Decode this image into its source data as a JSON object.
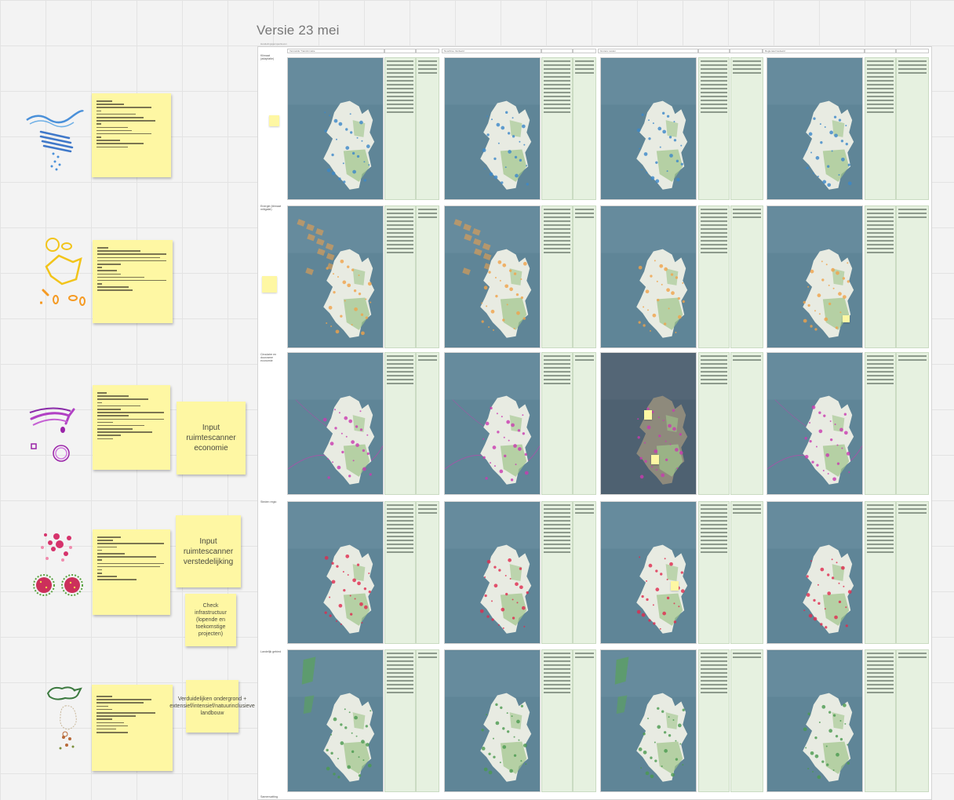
{
  "board": {
    "title": "Versie 23 mei",
    "subtitle": "Handelingsperspectieven",
    "columns": [
      {
        "title": "Versnelde Transformatie"
      },
      {
        "title": "Noordzee Verdeeld"
      },
      {
        "title": "Grotere Lasten"
      },
      {
        "title": "Regionaal Gedeeld"
      }
    ],
    "rows": [
      {
        "label": "Klimaat (adaptatie)",
        "accent": "#3b87c9"
      },
      {
        "label": "Energie (klimaat mitigatie)",
        "accent": "#f0a24a"
      },
      {
        "label": "Circulaire en duurzame economie",
        "accent": "#c93ab0"
      },
      {
        "label": "Steden regio",
        "accent": "#e0294e"
      },
      {
        "label": "Landelijk gebied",
        "accent": "#4a9a4f"
      },
      {
        "label": "Samenvatting"
      }
    ]
  },
  "stickies": {
    "economie": "Input ruimtescanner economie",
    "verstedelijking": "Input ruimtescanner verstedelijking",
    "infrastructuur": "Check infrastructuur (lopende en toekomstige projecten)",
    "landbouw": "Verduidelijken ondergrond + extensief/intensief/natuurinclusieve landbouw"
  },
  "colors": {
    "sea": "#5b8193",
    "land": "#e9ece3",
    "sticky": "#fef7a3",
    "textcol": "#e6f1e0"
  }
}
